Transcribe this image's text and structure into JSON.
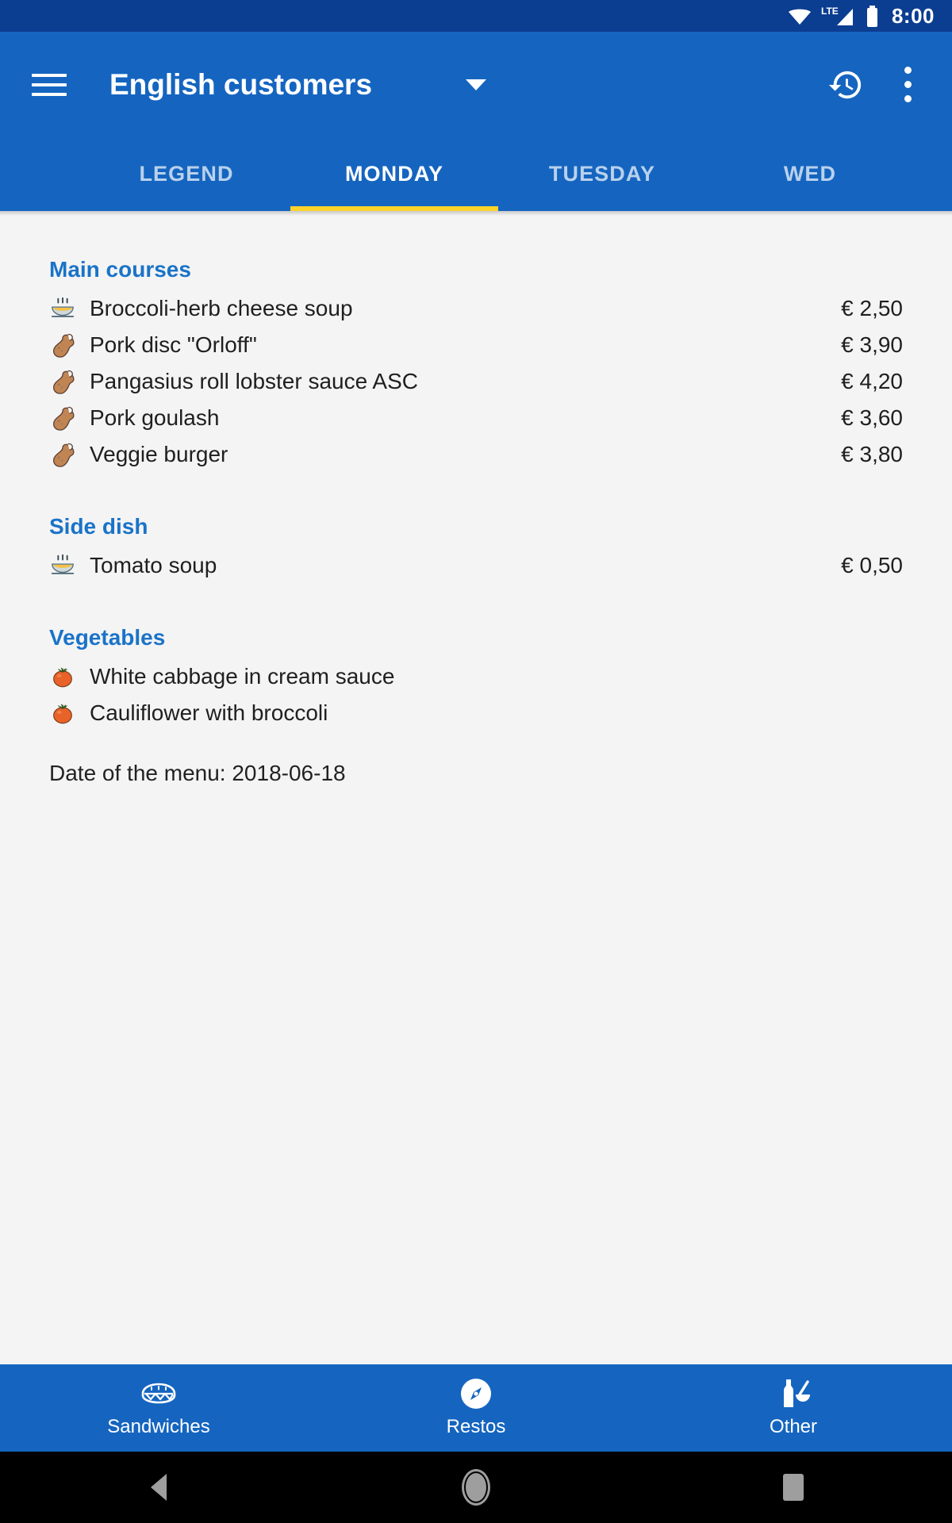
{
  "status_bar": {
    "network_label": "LTE",
    "time": "8:00",
    "icons": [
      "wifi-icon",
      "cellular-signal-icon",
      "battery-icon"
    ],
    "background_color": "#0b3d91"
  },
  "app_bar": {
    "menu_icon": "hamburger-menu-icon",
    "title": "English customers",
    "dropdown_icon": "caret-down-icon",
    "history_icon": "history-icon",
    "overflow_icon": "more-vertical-icon",
    "background_color": "#1565c0"
  },
  "tabs": {
    "indicator_color": "#ffd32a",
    "active_index": 1,
    "items": [
      {
        "label": "LEGEND",
        "active": false
      },
      {
        "label": "MONDAY",
        "active": true
      },
      {
        "label": "TUESDAY",
        "active": false
      },
      {
        "label": "WED",
        "active": false
      }
    ]
  },
  "menu": {
    "heading_color": "#1a73c8",
    "sections": [
      {
        "title": "Main courses",
        "items": [
          {
            "icon": "soup-bowl-icon",
            "name": "Broccoli-herb cheese soup",
            "price": "€ 2,50"
          },
          {
            "icon": "meat-leg-icon",
            "name": "Pork disc \"Orloff\"",
            "price": "€ 3,90"
          },
          {
            "icon": "meat-leg-icon",
            "name": "Pangasius roll lobster sauce ASC",
            "price": "€ 4,20"
          },
          {
            "icon": "meat-leg-icon",
            "name": "Pork goulash",
            "price": "€ 3,60"
          },
          {
            "icon": "meat-leg-icon",
            "name": "Veggie burger",
            "price": "€ 3,80"
          }
        ]
      },
      {
        "title": "Side dish",
        "items": [
          {
            "icon": "soup-bowl-icon",
            "name": "Tomato soup",
            "price": "€ 0,50"
          }
        ]
      },
      {
        "title": "Vegetables",
        "items": [
          {
            "icon": "tomato-icon",
            "name": "White cabbage in cream sauce",
            "price": ""
          },
          {
            "icon": "tomato-icon",
            "name": "Cauliflower with broccoli",
            "price": ""
          }
        ]
      }
    ],
    "date_line": "Date of the menu: 2018-06-18"
  },
  "bottom_nav": {
    "background_color": "#1565c0",
    "items": [
      {
        "label": "Sandwiches",
        "icon": "sandwich-icon"
      },
      {
        "label": "Restos",
        "icon": "compass-icon"
      },
      {
        "label": "Other",
        "icon": "bottle-and-bowl-icon"
      }
    ]
  },
  "system_nav": {
    "back": "back-triangle-icon",
    "home": "home-circle-icon",
    "recents": "recents-square-icon"
  }
}
